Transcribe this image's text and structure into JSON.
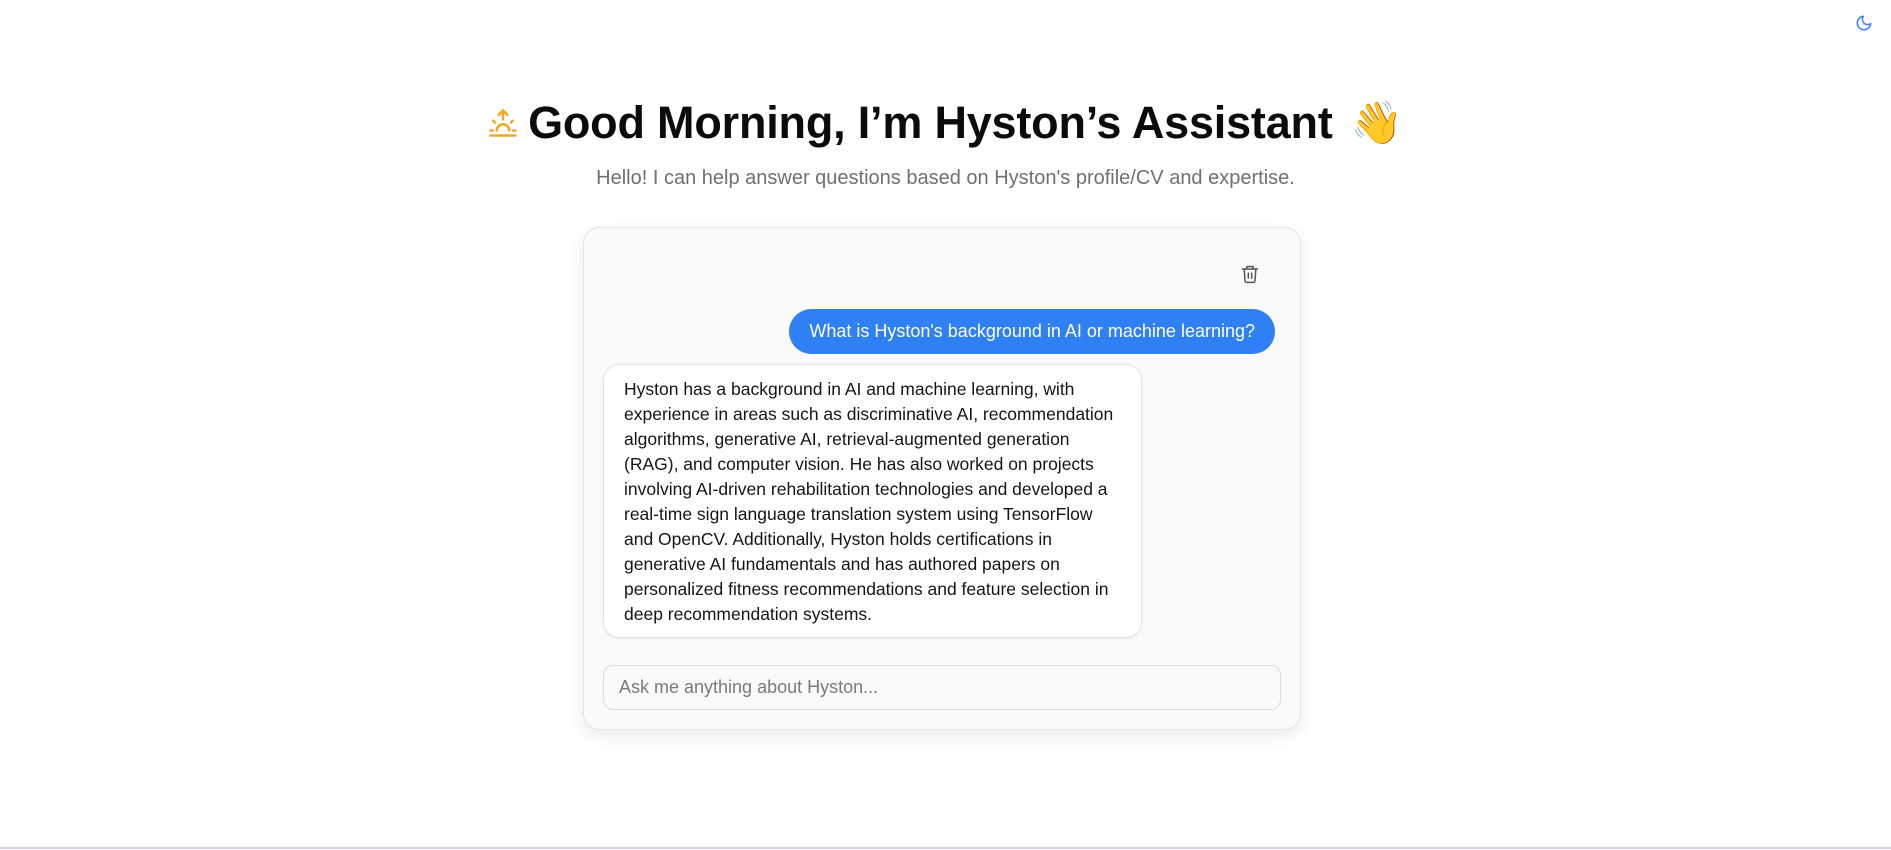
{
  "header": {
    "sunrise_icon": "sunrise-icon",
    "title": "Good Morning, I’m Hyston’s Assistant",
    "wave_emoji": "👋",
    "subtitle": "Hello! I can help answer questions based on Hyston's profile/CV and expertise."
  },
  "toolbar": {
    "theme_toggle_icon": "moon-icon",
    "clear_chat_icon": "trash-icon"
  },
  "chat": {
    "messages": [
      {
        "role": "user",
        "text": "What is Hyston's background in AI or machine learning?"
      },
      {
        "role": "assistant",
        "text": "Hyston has a background in AI and machine learning, with experience in areas such as discriminative AI, recommendation algorithms, generative AI, retrieval-augmented generation (RAG), and computer vision. He has also worked on projects involving AI-driven rehabilitation technologies and developed a real-time sign language translation system using TensorFlow and OpenCV. Additionally, Hyston holds certifications in generative AI fundamentals and has authored papers on personalized fitness recommendations and feature selection in deep recommendation systems."
      }
    ],
    "input": {
      "value": "",
      "placeholder": "Ask me anything about Hyston..."
    }
  },
  "colors": {
    "accent": "#2f80f5",
    "sunrise": "#f5a623",
    "moon": "#3b82f6"
  }
}
